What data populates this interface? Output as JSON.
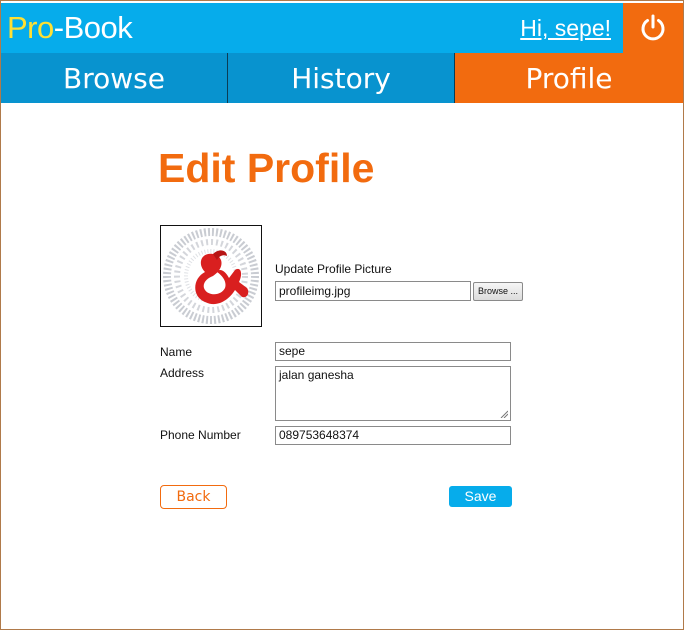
{
  "header": {
    "logo_pro": "Pro",
    "logo_rest": "-Book",
    "greeting": "Hi, sepe!",
    "power_icon": "power-icon"
  },
  "nav": {
    "tabs": [
      {
        "label": "Browse",
        "active": false
      },
      {
        "label": "History",
        "active": false
      },
      {
        "label": "Profile",
        "active": true
      }
    ]
  },
  "main": {
    "title": "Edit Profile",
    "picture": {
      "label": "Update Profile Picture",
      "file_value": "profileimg.jpg",
      "browse_label": "Browse ..."
    },
    "form": {
      "name_label": "Name",
      "name_value": "sepe",
      "address_label": "Address",
      "address_value": "jalan ganesha",
      "phone_label": "Phone Number",
      "phone_value": "089753648374"
    },
    "back_label": "Back",
    "save_label": "Save"
  },
  "colors": {
    "header_blue": "#06aceb",
    "tab_blue": "#0893cf",
    "accent_orange": "#f26b0f",
    "logo_yellow": "#ffe033"
  }
}
